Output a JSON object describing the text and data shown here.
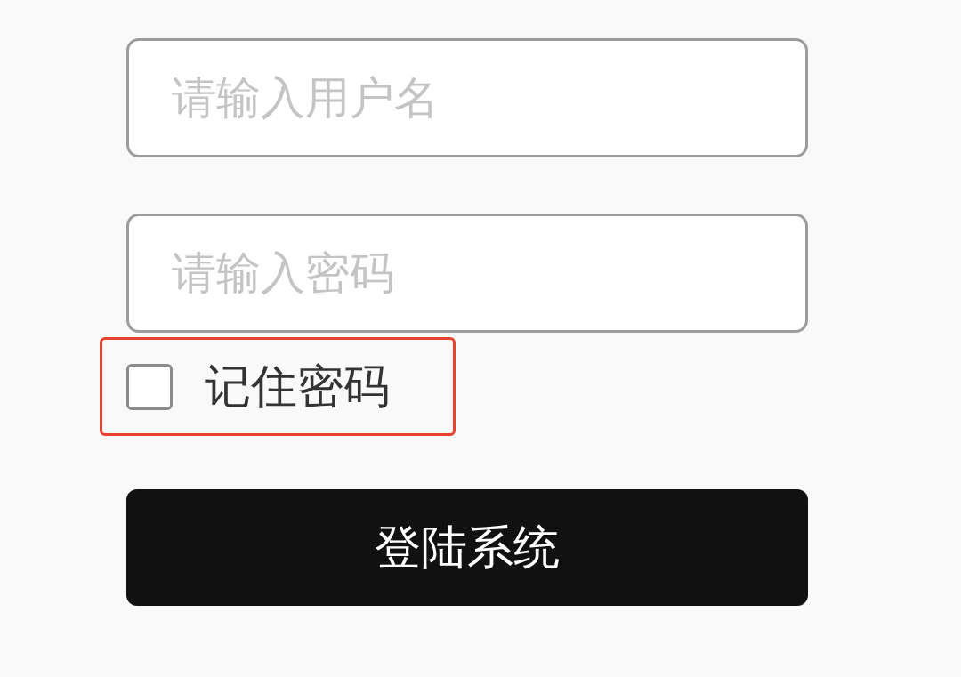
{
  "fields": [
    {
      "placeholder": "请输入用户名"
    },
    {
      "placeholder": "请输入密码"
    }
  ],
  "remember": {
    "label": "记住密码",
    "checked": false,
    "highlighted": true
  },
  "login_button": {
    "label": "登陆系统"
  }
}
